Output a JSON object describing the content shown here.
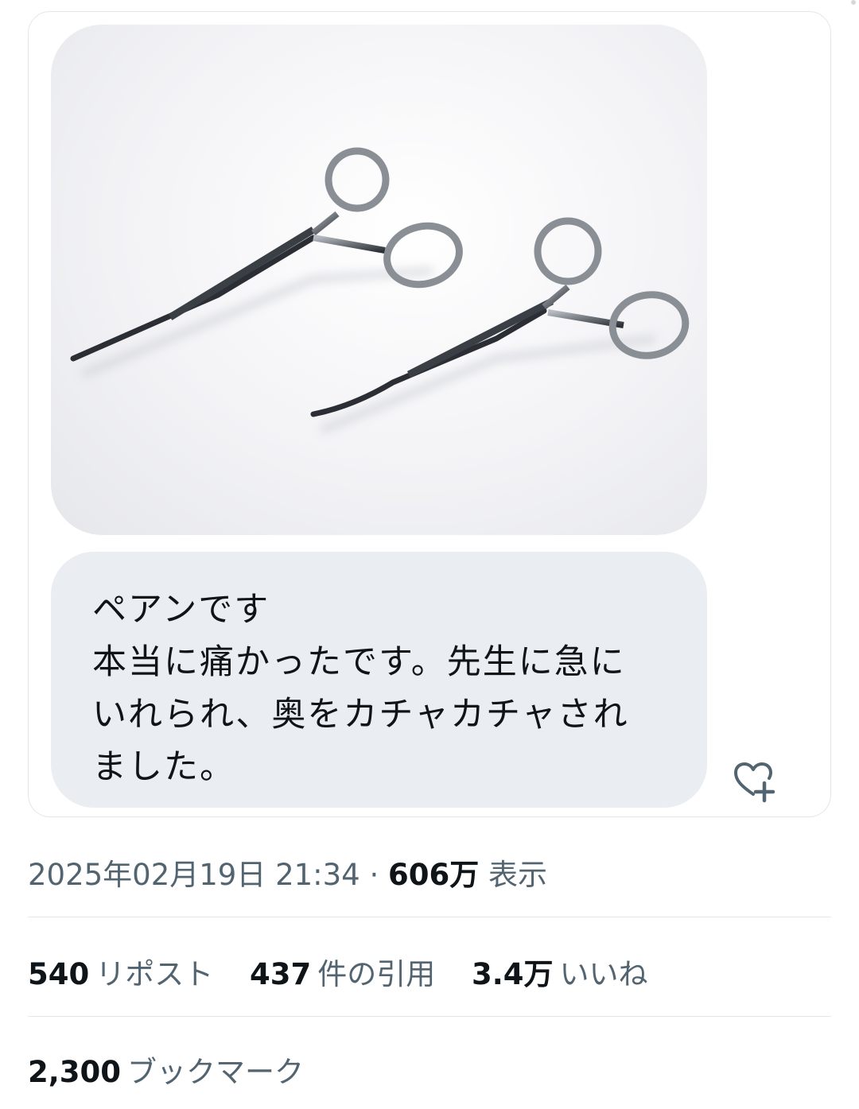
{
  "post": {
    "message_text": "ペアンです\n本当に痛かったです。先生に急に\nいれられ、奥をカチャカチャされ\nました。",
    "react_icon": "heart-plus-icon",
    "photo_subject": "surgical-forceps"
  },
  "meta": {
    "timestamp": "2025年02月19日 21:34",
    "separator": "·",
    "views_count": "606万",
    "views_label": "表示"
  },
  "stats": [
    {
      "count": "540",
      "label": "リポスト"
    },
    {
      "count": "437",
      "label": "件の引用"
    },
    {
      "count": "3.4万",
      "label": "いいね"
    }
  ],
  "bookmarks": {
    "count": "2,300",
    "label": "ブックマーク"
  },
  "colors": {
    "muted": "#536471",
    "text": "#0f1419",
    "bubble": "#eaeef2",
    "border": "#e3e6ea"
  }
}
